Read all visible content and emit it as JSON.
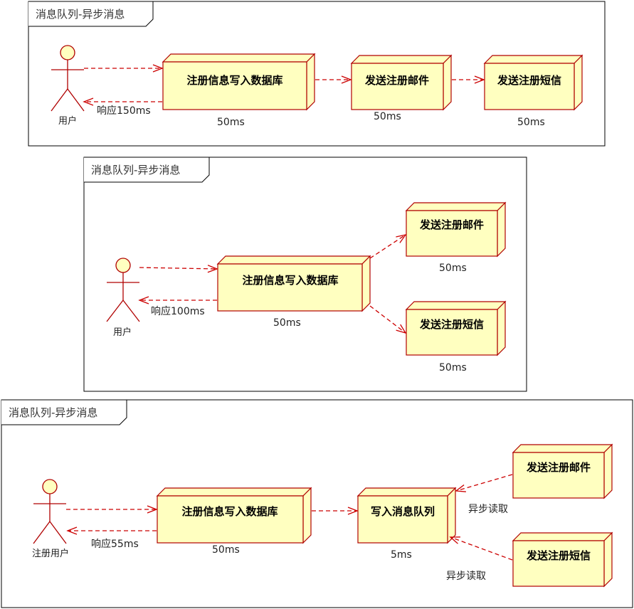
{
  "colors": {
    "node_fill": "#ffffc0",
    "node_stroke": "#b00000",
    "arrow": "#cc0000",
    "frame": "#000000"
  },
  "diagram1": {
    "frame_title": "消息队列-异步消息",
    "actor": "用户",
    "node_db": "注册信息写入数据库",
    "node_email": "发送注册邮件",
    "node_sms": "发送注册短信",
    "response": "响应150ms",
    "time_db": "50ms",
    "time_email": "50ms",
    "time_sms": "50ms"
  },
  "diagram2": {
    "frame_title": "消息队列-异步消息",
    "actor": "用户",
    "node_db": "注册信息写入数据库",
    "node_email": "发送注册邮件",
    "node_sms": "发送注册短信",
    "response": "响应100ms",
    "time_db": "50ms",
    "time_email": "50ms",
    "time_sms": "50ms"
  },
  "diagram3": {
    "frame_title": "消息队列-异步消息",
    "actor": "注册用户",
    "node_db": "注册信息写入数据库",
    "node_mq": "写入消息队列",
    "node_email": "发送注册邮件",
    "node_sms": "发送注册短信",
    "response": "响应55ms",
    "time_db": "50ms",
    "time_mq": "5ms",
    "async_read_1": "异步读取",
    "async_read_2": "异步读取"
  }
}
